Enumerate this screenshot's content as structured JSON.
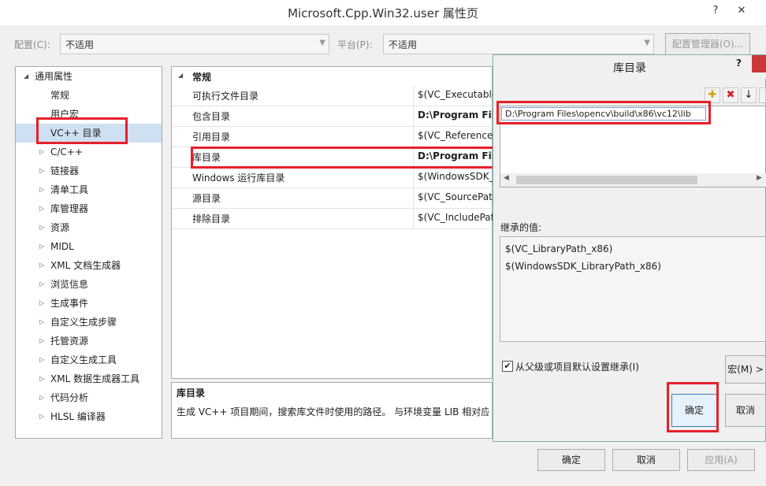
{
  "window": {
    "title": "Microsoft.Cpp.Win32.user 属性页",
    "help_btn": "?",
    "close_btn": "✕"
  },
  "toolbar": {
    "config_label": "配置(C):",
    "config_value": "不适用",
    "platform_label": "平台(P):",
    "platform_value": "不适用",
    "config_manager": "配置管理器(O)..."
  },
  "tree": {
    "root": "通用属性",
    "items": [
      "常规",
      "用户宏",
      "VC++ 目录",
      "C/C++",
      "链接器",
      "清单工具",
      "库管理器",
      "资源",
      "MIDL",
      "XML 文档生成器",
      "浏览信息",
      "生成事件",
      "自定义生成步骤",
      "托管资源",
      "自定义生成工具",
      "XML 数据生成器工具",
      "代码分析",
      "HLSL 编译器"
    ]
  },
  "grid": {
    "section": "常规",
    "rows": [
      {
        "key": "可执行文件目录",
        "value": "$(VC_ExecutableP"
      },
      {
        "key": "包含目录",
        "value": "D:\\Program Files\\"
      },
      {
        "key": "引用目录",
        "value": "$(VC_ReferencesP"
      },
      {
        "key": "库目录",
        "value": "D:\\Program Files"
      },
      {
        "key": "Windows 运行库目录",
        "value": "$(WindowsSDK_M"
      },
      {
        "key": "源目录",
        "value": "$(VC_SourcePath)"
      },
      {
        "key": "排除目录",
        "value": "$(VC_IncludePath"
      }
    ]
  },
  "description": {
    "title": "库目录",
    "text": "生成 VC++ 项目期间，搜索库文件时使用的路径。 与环境变量 LIB 相对应。"
  },
  "buttons": {
    "ok": "确定",
    "cancel": "取消",
    "apply": "应用(A)"
  },
  "dialog": {
    "title": "库目录",
    "help": "?",
    "entry": "D:\\Program Files\\opencv\\build\\x86\\vc12\\lib",
    "inherited_label": "继承的值:",
    "inherited": [
      "$(VC_LibraryPath_x86)",
      "$(WindowsSDK_LibraryPath_x86)"
    ],
    "inherit_checkbox": "从父级或项目默认设置继承(I)",
    "macro_btn": "宏(M) >",
    "ok": "确定",
    "cancel": "取消"
  },
  "colors": {
    "highlight_red": "#e8202a",
    "selection": "#cfe0f2",
    "dialog_border": "#7fb3a8"
  }
}
